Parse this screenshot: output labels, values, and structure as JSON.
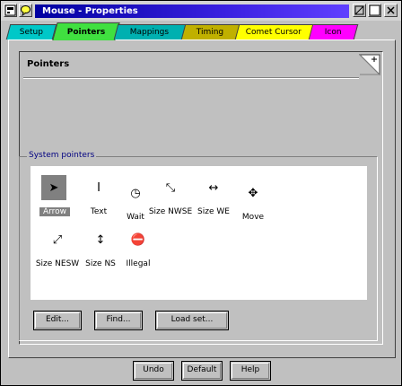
{
  "window": {
    "title": "Mouse - Properties"
  },
  "tabs": [
    {
      "label": "Setup",
      "color": "#00c8c8",
      "active": false
    },
    {
      "label": "Pointers",
      "color": "#40e040",
      "active": true
    },
    {
      "label": "Mappings",
      "color": "#00b0b0",
      "active": false
    },
    {
      "label": "Timing",
      "color": "#c0b000",
      "active": false
    },
    {
      "label": "Comet Cursor",
      "color": "#ffff00",
      "active": false
    },
    {
      "label": "Icon",
      "color": "#ff00ff",
      "active": false
    }
  ],
  "page": {
    "title": "Pointers"
  },
  "group": {
    "label": "System pointers"
  },
  "pointers": [
    {
      "label": "Arrow",
      "icon": "arrow-pointer-icon",
      "glyph": "➤",
      "selected": true
    },
    {
      "label": "Text",
      "icon": "text-ibeam-icon",
      "glyph": "I",
      "selected": false
    },
    {
      "label": "Wait",
      "icon": "wait-clock-icon",
      "glyph": "◷",
      "selected": false
    },
    {
      "label": "Size NWSE",
      "icon": "resize-nwse-icon",
      "glyph": "⤡",
      "selected": false
    },
    {
      "label": "Size WE",
      "icon": "resize-we-icon",
      "glyph": "↔",
      "selected": false
    },
    {
      "label": "Move",
      "icon": "move-icon",
      "glyph": "✥",
      "selected": false
    },
    {
      "label": "Size NESW",
      "icon": "resize-nesw-icon",
      "glyph": "⤢",
      "selected": false
    },
    {
      "label": "Size NS",
      "icon": "resize-ns-icon",
      "glyph": "↕",
      "selected": false
    },
    {
      "label": "Illegal",
      "icon": "illegal-icon",
      "glyph": "⛔",
      "selected": false
    }
  ],
  "group_buttons": {
    "edit": "Edit...",
    "find": "Find...",
    "load": "Load set..."
  },
  "footer": {
    "undo": "Undo",
    "default": "Default",
    "help": "Help"
  }
}
